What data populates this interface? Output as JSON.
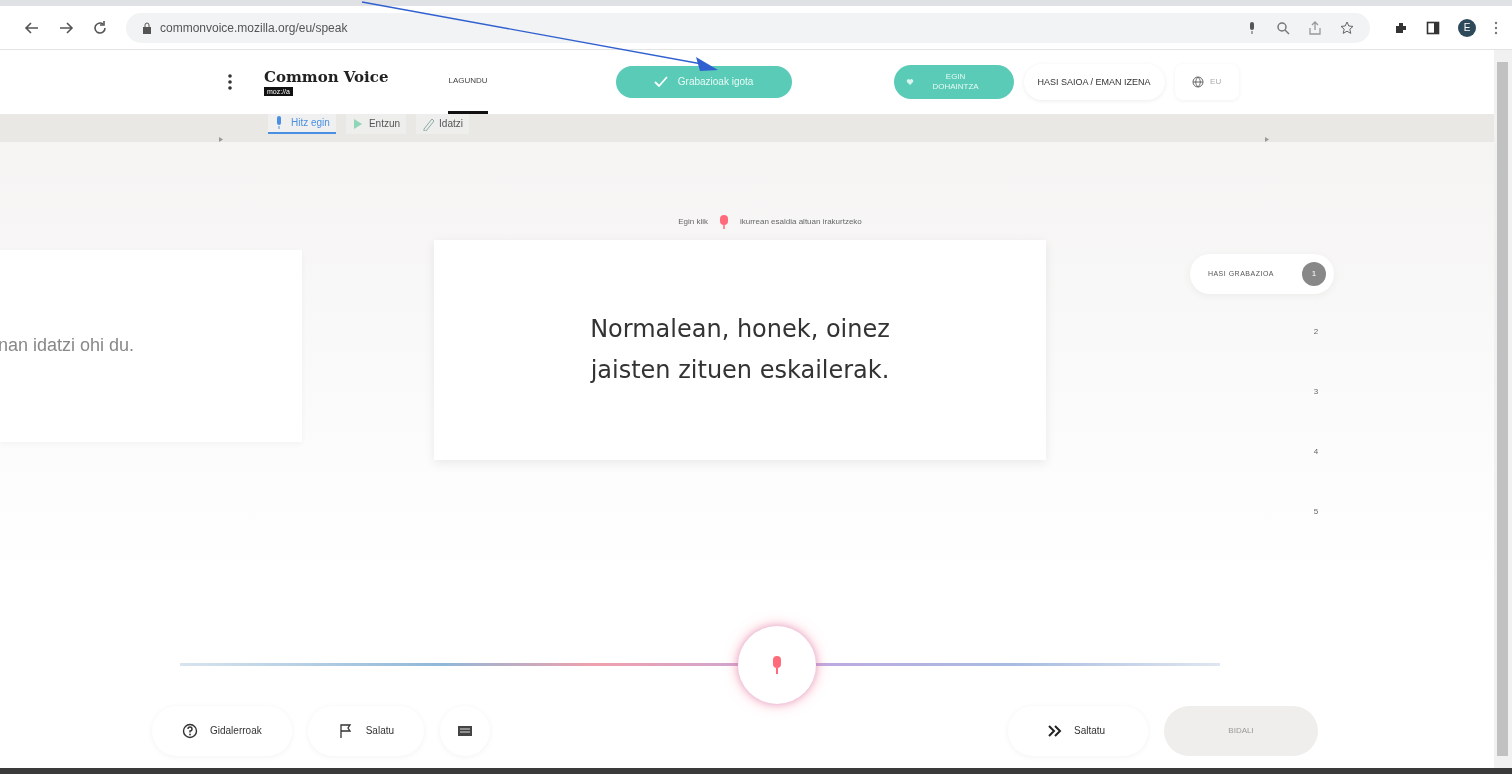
{
  "browser": {
    "url": "commonvoice.mozilla.org/eu/speak",
    "profile_initial": "E"
  },
  "header": {
    "logo_title": "Common Voice",
    "logo_badge": "moz://a",
    "nav": [
      {
        "label": "LAGUNDU",
        "selected": true
      }
    ],
    "upload_button": "Grabazioak igota",
    "donate_button": "EGIN DOHAINTZA",
    "login_button": "HASI SAIOA / EMAN IZENA",
    "language": "EU"
  },
  "subnav": [
    {
      "label": "Hitz egin",
      "selected": true,
      "kind": "mic"
    },
    {
      "label": "Entzun",
      "selected": false,
      "kind": "play"
    },
    {
      "label": "Idatzi",
      "selected": false,
      "kind": "pen"
    }
  ],
  "instruction": {
    "before": "Egin klik",
    "after": "ikurrean esaldia altuan irakurtzeko"
  },
  "previous_sentence": "nan idatzi ohi du.",
  "sentence": "Normalean, honek, oinez jaisten zituen eskailerak.",
  "steps": [
    {
      "label": "HASI GRABAZIOA",
      "number": "1",
      "selected": true
    },
    {
      "number": "2",
      "selected": false
    },
    {
      "number": "3",
      "selected": false
    },
    {
      "number": "4",
      "selected": false
    },
    {
      "number": "5",
      "selected": false
    }
  ],
  "footer": {
    "left": [
      {
        "label": "Gidalerroak",
        "kind": "help"
      },
      {
        "label": "Salatu",
        "kind": "flag"
      },
      {
        "kind": "keyboard"
      }
    ],
    "skip_button": "Saltatu",
    "submit_button": {
      "label": "BIDALI",
      "disabled": true
    }
  },
  "annotation": {
    "kind": "arrow"
  }
}
